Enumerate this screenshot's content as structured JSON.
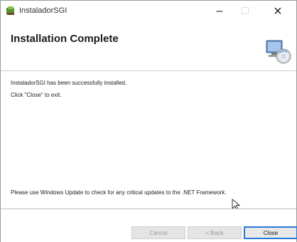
{
  "window": {
    "title": "InstaladorSGI",
    "minimize_glyph": "–",
    "maximize_glyph": "□",
    "close_glyph": "×"
  },
  "header": {
    "title": "Installation Complete",
    "graphic_icon": "computer-cd-icon"
  },
  "content": {
    "line1": "InstaladorSGI has been successfully installed.",
    "line2": "Click \"Close\" to exit.",
    "line3": "Please use Windows Update to check for any critical updates to the .NET Framework."
  },
  "footer": {
    "cancel_label": "Cancel",
    "back_label": "< Back",
    "close_label": "Close"
  },
  "colors": {
    "close_focus": "#2a7ad6"
  }
}
